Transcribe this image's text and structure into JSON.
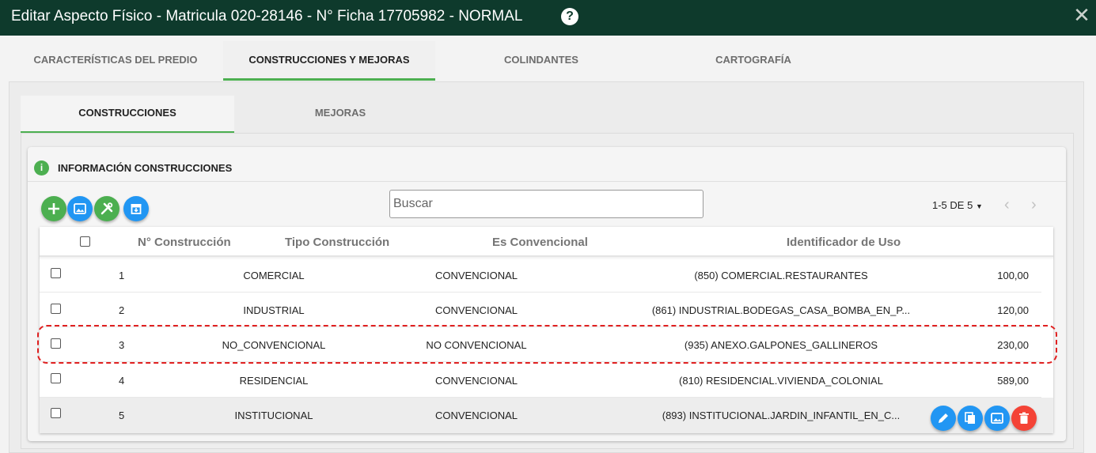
{
  "window": {
    "title": "Editar Aspecto Físico - Matricula 020-28146 - N° Ficha 17705982 - NORMAL",
    "help_glyph": "?",
    "close_glyph": "✕"
  },
  "main_tabs": [
    {
      "label": "CARACTERÍSTICAS DEL PREDIO"
    },
    {
      "label": "CONSTRUCCIONES Y MEJORAS"
    },
    {
      "label": "COLINDANTES"
    },
    {
      "label": "CARTOGRAFÍA"
    }
  ],
  "sub_tabs": [
    {
      "label": "CONSTRUCCIONES"
    },
    {
      "label": "MEJORAS"
    }
  ],
  "card": {
    "info_glyph": "i",
    "title": "INFORMACIÓN CONSTRUCCIONES"
  },
  "toolbar": {
    "add_icon": "plus-icon",
    "image_icon": "image-icon",
    "tools_icon": "tools-icon",
    "archive_icon": "archive-icon"
  },
  "search": {
    "placeholder": "Buscar",
    "value": ""
  },
  "pagination": {
    "range": "1-5 DE 5",
    "prev": "‹",
    "next": "›"
  },
  "table": {
    "headers": [
      "N° Construcción",
      "Tipo Construcción",
      "Es Convencional",
      "Identificador de Uso"
    ],
    "rows": [
      {
        "num": "1",
        "tipo": "COMERCIAL",
        "conv": "CONVENCIONAL",
        "uso": "(850) COMERCIAL.RESTAURANTES",
        "valor": "100,00"
      },
      {
        "num": "2",
        "tipo": "INDUSTRIAL",
        "conv": "CONVENCIONAL",
        "uso": "(861) INDUSTRIAL.BODEGAS_CASA_BOMBA_EN_P...",
        "valor": "120,00"
      },
      {
        "num": "3",
        "tipo": "NO_CONVENCIONAL",
        "conv": "NO CONVENCIONAL",
        "uso": "(935) ANEXO.GALPONES_GALLINEROS",
        "valor": "230,00"
      },
      {
        "num": "4",
        "tipo": "RESIDENCIAL",
        "conv": "CONVENCIONAL",
        "uso": "(810) RESIDENCIAL.VIVIENDA_COLONIAL",
        "valor": "589,00"
      },
      {
        "num": "5",
        "tipo": "INSTITUCIONAL",
        "conv": "CONVENCIONAL",
        "uso": "(893) INSTITUCIONAL.JARDIN_INFANTIL_EN_C...",
        "valor": ""
      }
    ]
  },
  "row_actions": [
    "edit-icon",
    "copy-icon",
    "image-icon",
    "delete-icon"
  ],
  "colors": {
    "header_bg": "#0e3a2c",
    "accent_green": "#4caf50",
    "action_blue": "#2196f3",
    "delete_red": "#f44336",
    "highlight_dash": "#e02020"
  }
}
